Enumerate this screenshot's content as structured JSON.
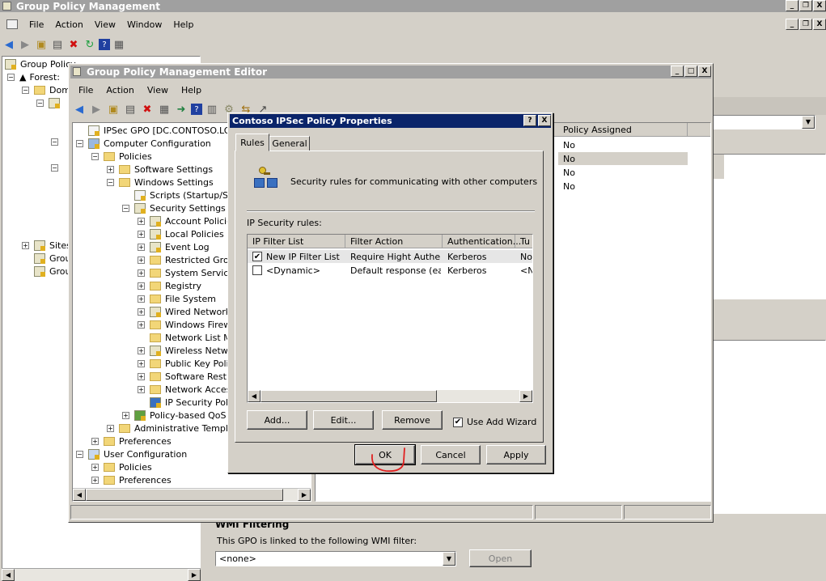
{
  "outer": {
    "title": "Group Policy Management",
    "menu": [
      "File",
      "Action",
      "View",
      "Window",
      "Help"
    ],
    "tree": [
      "Group Policy",
      "Forest:",
      "Dom",
      "Sites",
      "Grou",
      "Grou"
    ],
    "policy_col": "Policy Assigned",
    "policy_vals": [
      "No",
      "No",
      "No",
      "No"
    ],
    "wmi_title": "WMI Filtering",
    "wmi_text": "This GPO is linked to the following WMI filter:",
    "wmi_value": "<none>",
    "open_label": "Open"
  },
  "editor": {
    "title": "Group Policy Management Editor",
    "menu": [
      "File",
      "Action",
      "View",
      "Help"
    ],
    "tree": [
      {
        "label": "IPSec GPO [DC.CONTOSO.LOCAL]",
        "lvl": 0,
        "pm": "",
        "icon": "doc"
      },
      {
        "label": "Computer Configuration",
        "lvl": 0,
        "pm": "−",
        "icon": "pc"
      },
      {
        "label": "Policies",
        "lvl": 1,
        "pm": "−",
        "icon": "fold"
      },
      {
        "label": "Software Settings",
        "lvl": 2,
        "pm": "+",
        "icon": "fold"
      },
      {
        "label": "Windows Settings",
        "lvl": 2,
        "pm": "−",
        "icon": "fold"
      },
      {
        "label": "Scripts (Startup/Shu",
        "lvl": 3,
        "pm": "",
        "icon": "doc"
      },
      {
        "label": "Security Settings",
        "lvl": 3,
        "pm": "−",
        "icon": "sec"
      },
      {
        "label": "Account Policies",
        "lvl": 4,
        "pm": "+",
        "icon": "sec"
      },
      {
        "label": "Local Policies",
        "lvl": 4,
        "pm": "+",
        "icon": "sec"
      },
      {
        "label": "Event Log",
        "lvl": 4,
        "pm": "+",
        "icon": "sec"
      },
      {
        "label": "Restricted Grou",
        "lvl": 4,
        "pm": "+",
        "icon": "fold"
      },
      {
        "label": "System Service",
        "lvl": 4,
        "pm": "+",
        "icon": "fold"
      },
      {
        "label": "Registry",
        "lvl": 4,
        "pm": "+",
        "icon": "fold"
      },
      {
        "label": "File System",
        "lvl": 4,
        "pm": "+",
        "icon": "fold"
      },
      {
        "label": "Wired Network",
        "lvl": 4,
        "pm": "+",
        "icon": "sec"
      },
      {
        "label": "Windows Firewa",
        "lvl": 4,
        "pm": "+",
        "icon": "fold"
      },
      {
        "label": "Network List Ma",
        "lvl": 4,
        "pm": "",
        "icon": "fold"
      },
      {
        "label": "Wireless Netwo",
        "lvl": 4,
        "pm": "+",
        "icon": "sec"
      },
      {
        "label": "Public Key Polici",
        "lvl": 4,
        "pm": "+",
        "icon": "fold"
      },
      {
        "label": "Software Restr",
        "lvl": 4,
        "pm": "+",
        "icon": "fold"
      },
      {
        "label": "Network Access",
        "lvl": 4,
        "pm": "+",
        "icon": "fold"
      },
      {
        "label": "IP Security Polic",
        "lvl": 4,
        "pm": "",
        "icon": "ipsec"
      },
      {
        "label": "Policy-based QoS",
        "lvl": 3,
        "pm": "+",
        "icon": "chart"
      },
      {
        "label": "Administrative Template",
        "lvl": 2,
        "pm": "+",
        "icon": "fold"
      },
      {
        "label": "Preferences",
        "lvl": 1,
        "pm": "+",
        "icon": "fold"
      },
      {
        "label": "User Configuration",
        "lvl": 0,
        "pm": "−",
        "icon": "user"
      },
      {
        "label": "Policies",
        "lvl": 1,
        "pm": "+",
        "icon": "fold"
      },
      {
        "label": "Preferences",
        "lvl": 1,
        "pm": "+",
        "icon": "fold"
      }
    ]
  },
  "dialog": {
    "title": "Contoso IPSec Policy Properties",
    "tabs": [
      "Rules",
      "General"
    ],
    "description": "Security rules for communicating with other computers",
    "rules_label": "IP Security rules:",
    "columns": [
      "IP Filter List",
      "Filter Action",
      "Authentication...",
      "Tu"
    ],
    "rows": [
      {
        "checked": true,
        "filter": "New IP Filter List",
        "action": "Require Hight Authe...",
        "auth": "Kerberos",
        "tu": "No"
      },
      {
        "checked": false,
        "filter": "<Dynamic>",
        "action": "Default response (ea...",
        "auth": "Kerberos",
        "tu": "<N"
      }
    ],
    "add": "Add...",
    "edit": "Edit...",
    "remove": "Remove",
    "wizard": "Use Add Wizard",
    "wizard_checked": true,
    "ok": "OK",
    "cancel": "Cancel",
    "apply": "Apply",
    "help": "?",
    "close": "X"
  },
  "colors": {
    "annotation": "#e02020",
    "dialog_title": "#0a246a",
    "inactive_title": "#a0a0a0"
  }
}
